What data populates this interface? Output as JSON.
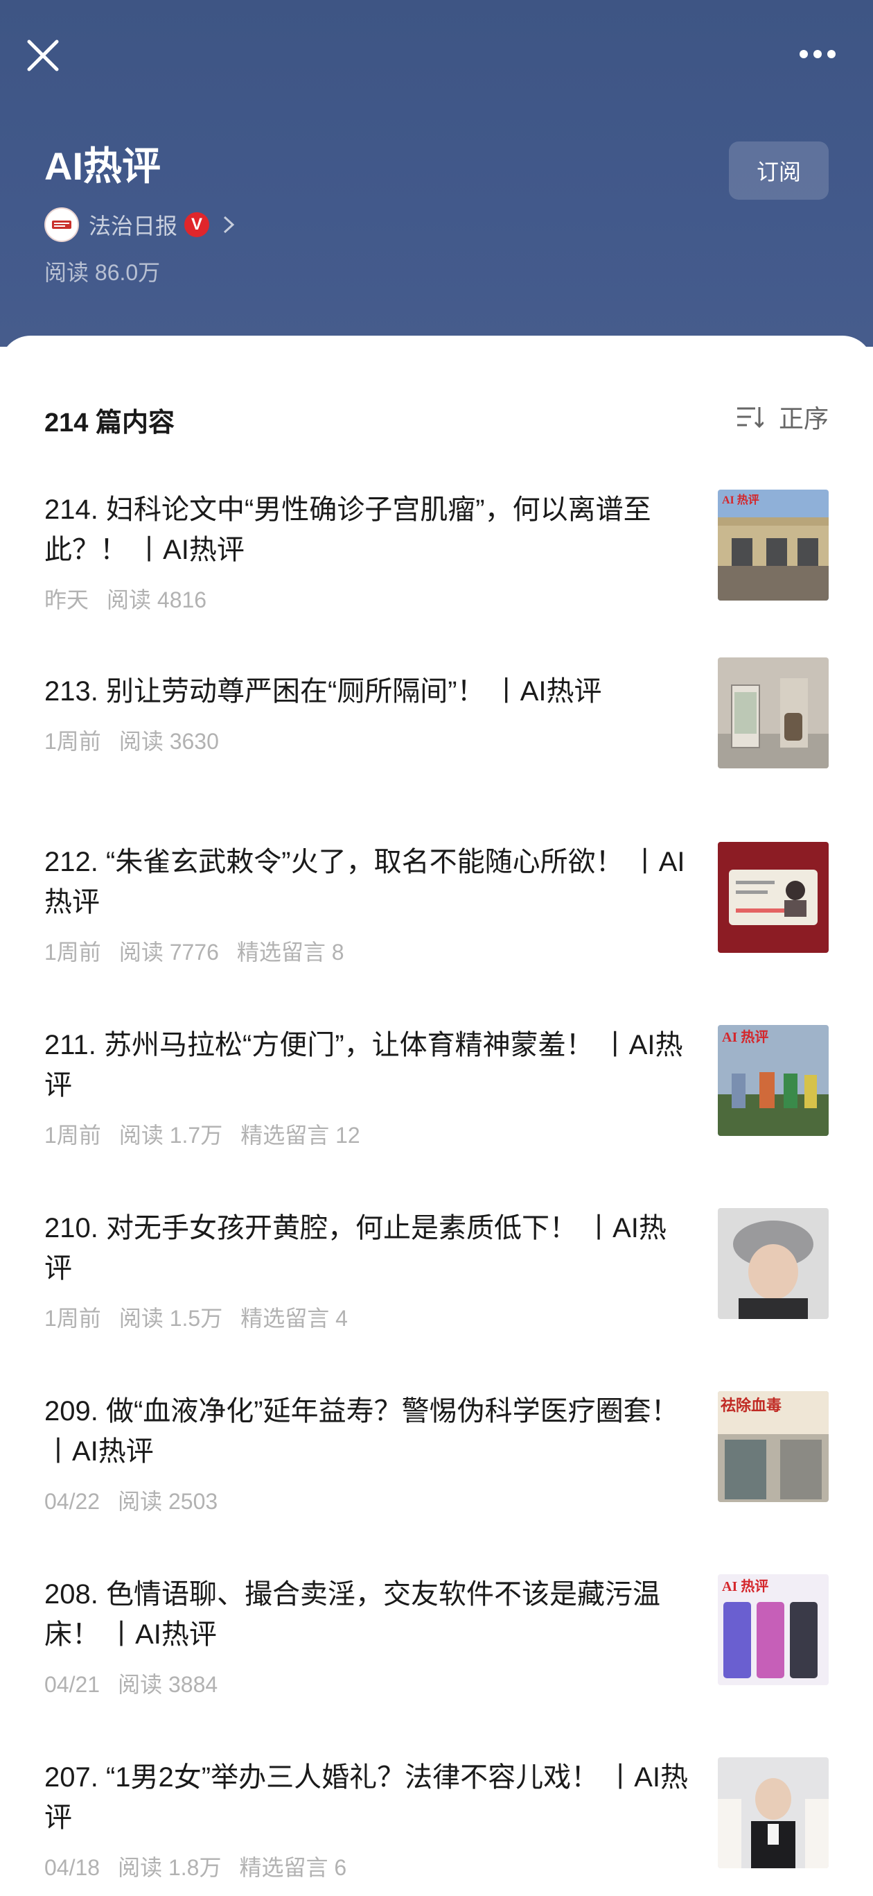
{
  "header": {
    "album_title": "AI热评",
    "subscribe_label": "订阅",
    "account_name": "法治日报",
    "verified_mark": "V",
    "read_count": "阅读 86.0万"
  },
  "list": {
    "count_label": "214 篇内容",
    "sort_label": "正序"
  },
  "articles": [
    {
      "title": "214. 妇科论文中“男性确诊子宫肌瘤”，何以离谱至此？！ 丨AI热评",
      "date": "昨天",
      "reads": "阅读 4816",
      "comments": "",
      "thumb": "building-thumbnail"
    },
    {
      "title": "213. 别让劳动尊严困在“厕所隔间”！ 丨AI热评",
      "date": "1周前",
      "reads": "阅读 3630",
      "comments": "",
      "thumb": "restroom-thumbnail"
    },
    {
      "title": "212. “朱雀玄武敕令”火了，取名不能随心所欲！ 丨AI热评",
      "date": "1周前",
      "reads": "阅读 7776",
      "comments": "精选留言 8",
      "thumb": "id-card-thumbnail"
    },
    {
      "title": "211. 苏州马拉松“方便门”，让体育精神蒙羞！ 丨AI热评",
      "date": "1周前",
      "reads": "阅读 1.7万",
      "comments": "精选留言 12",
      "thumb": "marathon-thumbnail"
    },
    {
      "title": "210. 对无手女孩开黄腔，何止是素质低下！ 丨AI热评",
      "date": "1周前",
      "reads": "阅读 1.5万",
      "comments": "精选留言 4",
      "thumb": "portrait-thumbnail"
    },
    {
      "title": "209. 做“血液净化”延年益寿？警惕伪科学医疗圈套！ 丨AI热评",
      "date": "04/22",
      "reads": "阅读 2503",
      "comments": "",
      "thumb": "storefront-thumbnail"
    },
    {
      "title": "208. 色情语聊、撮合卖淫，交友软件不该是藏污温床！ 丨AI热评",
      "date": "04/21",
      "reads": "阅读 3884",
      "comments": "",
      "thumb": "app-screens-thumbnail"
    },
    {
      "title": "207. “1男2女”举办三人婚礼？法律不容儿戏！ 丨AI热评",
      "date": "04/18",
      "reads": "阅读 1.8万",
      "comments": "精选留言 6",
      "thumb": "wedding-thumbnail"
    }
  ],
  "thumb_texts": {
    "ai_tag": "AI 热评",
    "storefront_sign": "祛除血毒"
  },
  "colors": {
    "header_bg": "#42598b",
    "badge_red": "#e0262b",
    "meta_gray": "#b2b2b2"
  }
}
